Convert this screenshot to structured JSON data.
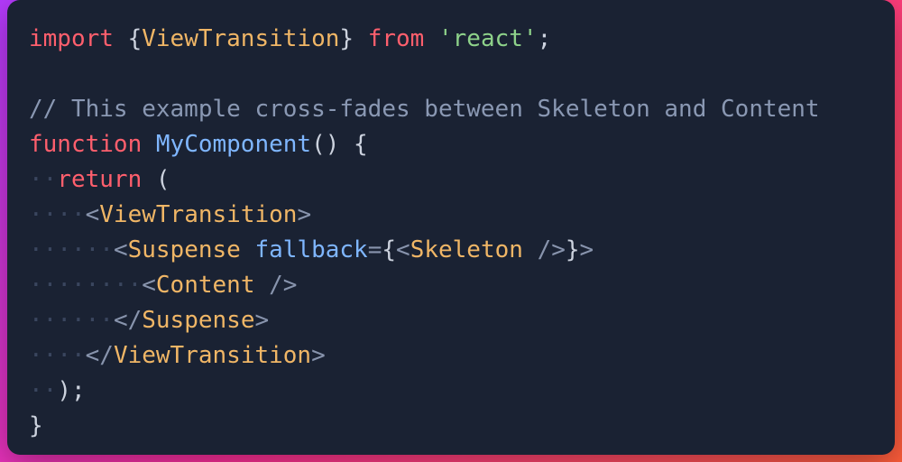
{
  "code": {
    "tokens": [
      {
        "kind": "kw",
        "text": "import"
      },
      {
        "kind": "sp",
        "text": " "
      },
      {
        "kind": "punc",
        "text": "{"
      },
      {
        "kind": "tag",
        "text": "ViewTransition"
      },
      {
        "kind": "punc",
        "text": "}"
      },
      {
        "kind": "sp",
        "text": " "
      },
      {
        "kind": "kw",
        "text": "from"
      },
      {
        "kind": "sp",
        "text": " "
      },
      {
        "kind": "str",
        "text": "'react'"
      },
      {
        "kind": "punc",
        "text": ";"
      },
      {
        "kind": "nl"
      },
      {
        "kind": "nl"
      },
      {
        "kind": "cmt",
        "text": "// This example cross-fades between Skeleton and Content"
      },
      {
        "kind": "nl"
      },
      {
        "kind": "kw",
        "text": "function"
      },
      {
        "kind": "sp",
        "text": " "
      },
      {
        "kind": "fnname",
        "text": "MyComponent"
      },
      {
        "kind": "punc",
        "text": "() {"
      },
      {
        "kind": "nl"
      },
      {
        "kind": "dots",
        "n": 2
      },
      {
        "kind": "kw",
        "text": "return"
      },
      {
        "kind": "sp",
        "text": " "
      },
      {
        "kind": "punc",
        "text": "("
      },
      {
        "kind": "nl"
      },
      {
        "kind": "dots",
        "n": 4
      },
      {
        "kind": "jsxpunc",
        "text": "<"
      },
      {
        "kind": "tag",
        "text": "ViewTransition"
      },
      {
        "kind": "jsxpunc",
        "text": ">"
      },
      {
        "kind": "nl"
      },
      {
        "kind": "dots",
        "n": 6
      },
      {
        "kind": "jsxpunc",
        "text": "<"
      },
      {
        "kind": "tag",
        "text": "Suspense"
      },
      {
        "kind": "sp",
        "text": " "
      },
      {
        "kind": "attr",
        "text": "fallback"
      },
      {
        "kind": "jsxpunc",
        "text": "="
      },
      {
        "kind": "punc",
        "text": "{"
      },
      {
        "kind": "jsxpunc",
        "text": "<"
      },
      {
        "kind": "tag",
        "text": "Skeleton"
      },
      {
        "kind": "sp",
        "text": " "
      },
      {
        "kind": "jsxpunc",
        "text": "/>"
      },
      {
        "kind": "punc",
        "text": "}"
      },
      {
        "kind": "jsxpunc",
        "text": ">"
      },
      {
        "kind": "nl"
      },
      {
        "kind": "dots",
        "n": 8
      },
      {
        "kind": "jsxpunc",
        "text": "<"
      },
      {
        "kind": "tag",
        "text": "Content"
      },
      {
        "kind": "sp",
        "text": " "
      },
      {
        "kind": "jsxpunc",
        "text": "/>"
      },
      {
        "kind": "nl"
      },
      {
        "kind": "dots",
        "n": 6
      },
      {
        "kind": "jsxpunc",
        "text": "</"
      },
      {
        "kind": "tag",
        "text": "Suspense"
      },
      {
        "kind": "jsxpunc",
        "text": ">"
      },
      {
        "kind": "nl"
      },
      {
        "kind": "dots",
        "n": 4
      },
      {
        "kind": "jsxpunc",
        "text": "</"
      },
      {
        "kind": "tag",
        "text": "ViewTransition"
      },
      {
        "kind": "jsxpunc",
        "text": ">"
      },
      {
        "kind": "nl"
      },
      {
        "kind": "dots",
        "n": 2
      },
      {
        "kind": "punc",
        "text": ");"
      },
      {
        "kind": "nl"
      },
      {
        "kind": "punc",
        "text": "}"
      }
    ]
  },
  "colors": {
    "bg": "#1a2233",
    "kw": "#ff5f6d",
    "str": "#8ed28a",
    "cmt": "#8a98b3",
    "tag": "#f0b666",
    "attr": "#7fb6ff"
  }
}
